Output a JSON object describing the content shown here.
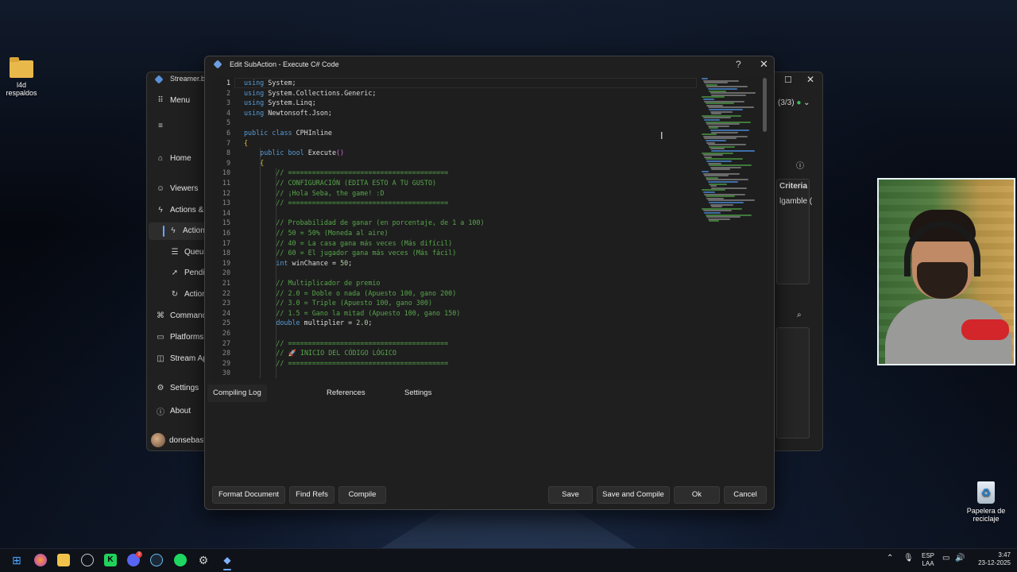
{
  "desktop": {
    "folder_label": "l4d respaldos",
    "recycle_label": "Papelera de reciclaje"
  },
  "bg_window": {
    "title": "Streamer.bo",
    "menu": "Menu",
    "tabs_count": "(3/3)",
    "col_criteria": "Criteria",
    "cell_value": "lgamble (",
    "sidebar": [
      {
        "icon": "home-icon",
        "label": "Home",
        "glyph": "⌂"
      },
      {
        "icon": "viewers-icon",
        "label": "Viewers",
        "glyph": "☺"
      },
      {
        "icon": "actions-icon",
        "label": "Actions &",
        "glyph": "ϟ"
      },
      {
        "icon": "action-icon",
        "label": "Action",
        "glyph": "ϟ"
      },
      {
        "icon": "queues-icon",
        "label": "Queu",
        "glyph": "☰"
      },
      {
        "icon": "pending-icon",
        "label": "Pendi",
        "glyph": "➚"
      },
      {
        "icon": "action-history-icon",
        "label": "Action",
        "glyph": "↻"
      },
      {
        "icon": "commands-icon",
        "label": "Command",
        "glyph": "⌘"
      },
      {
        "icon": "platforms-icon",
        "label": "Platforms",
        "glyph": "▭"
      },
      {
        "icon": "stream-apps-icon",
        "label": "Stream Ap",
        "glyph": "◫"
      },
      {
        "icon": "settings-icon",
        "label": "Settings",
        "glyph": "⚙"
      },
      {
        "icon": "about-icon",
        "label": "About",
        "glyph": "ⓘ"
      }
    ],
    "user": "donsebast"
  },
  "dialog": {
    "title": "Edit SubAction - Execute C# Code",
    "help": "?",
    "close": "✕",
    "code": [
      "using System;",
      "using System.Collections.Generic;",
      "using System.Linq;",
      "using Newtonsoft.Json;",
      "",
      "public class CPHInline",
      "{",
      "    public bool Execute()",
      "    {",
      "        // ========================================",
      "        // CONFIGURACIÓN (EDITA ESTO A TU GUSTO)",
      "        // ¡Hola Seba, the game! :D",
      "        // ========================================",
      "",
      "        // Probabilidad de ganar (en porcentaje, de 1 a 100)",
      "        // 50 = 50% (Moneda al aire)",
      "        // 40 = La casa gana más veces (Más difícil)",
      "        // 60 = El jugador gana más veces (Más fácil)",
      "        int winChance = 50;",
      "",
      "        // Multiplicador de premio",
      "        // 2.0 = Doble o nada (Apuesto 100, gano 200)",
      "        // 3.0 = Triple (Apuesto 100, gano 300)",
      "        // 1.5 = Gano la mitad (Apuesto 100, gano 150)",
      "        double multiplier = 2.0;",
      "",
      "        // ========================================",
      "        // 🚀 INICIO DEL CÓDIGO LÓGICO",
      "        // ========================================",
      ""
    ],
    "tabs": [
      "Compiling Log",
      "References",
      "Settings"
    ],
    "buttons": {
      "format": "Format Document",
      "find_refs": "Find Refs",
      "compile": "Compile",
      "save": "Save",
      "save_compile": "Save and Compile",
      "ok": "Ok",
      "cancel": "Cancel"
    }
  },
  "taskbar": {
    "lang_top": "ESP",
    "lang_bottom": "LAA",
    "time": "3:47",
    "date": "23-12-2025",
    "discord_badge": "3"
  },
  "colors": {
    "keyword": "#569cd6",
    "comment": "#57a64a",
    "number": "#b5cea8",
    "accent": "#6aa8ff"
  }
}
